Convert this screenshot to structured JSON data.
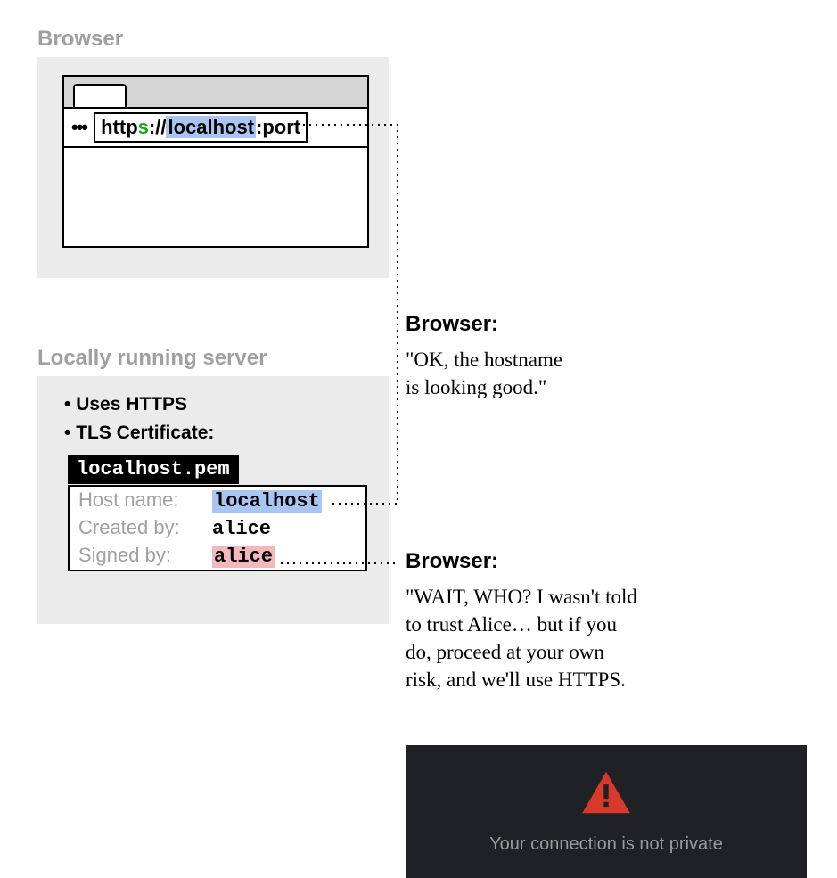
{
  "browser_section": {
    "label": "Browser",
    "url_dots": "•••",
    "url_prefix": "http",
    "url_s": "s",
    "url_sep": "://",
    "url_host": "localhost",
    "url_port": ":port"
  },
  "server_section": {
    "label": "Locally running server",
    "bullets": [
      "Uses HTTPS",
      "TLS Certificate:"
    ],
    "pem_file": "localhost.pem",
    "cert": {
      "labels": {
        "host": "Host name:",
        "created": "Created by:",
        "signed": "Signed by:"
      },
      "host": "localhost",
      "created": "alice",
      "signed": "alice"
    }
  },
  "speech1": {
    "heading": "Browser:",
    "body": "\"OK, the hostname\nis looking good.\""
  },
  "speech2": {
    "heading": "Browser:",
    "body": "\"WAIT, WHO? I wasn't told\nto trust Alice… but if you\ndo, proceed at your own\nrisk, and we'll use HTTPS."
  },
  "warning": {
    "text": "Your connection is not private"
  }
}
